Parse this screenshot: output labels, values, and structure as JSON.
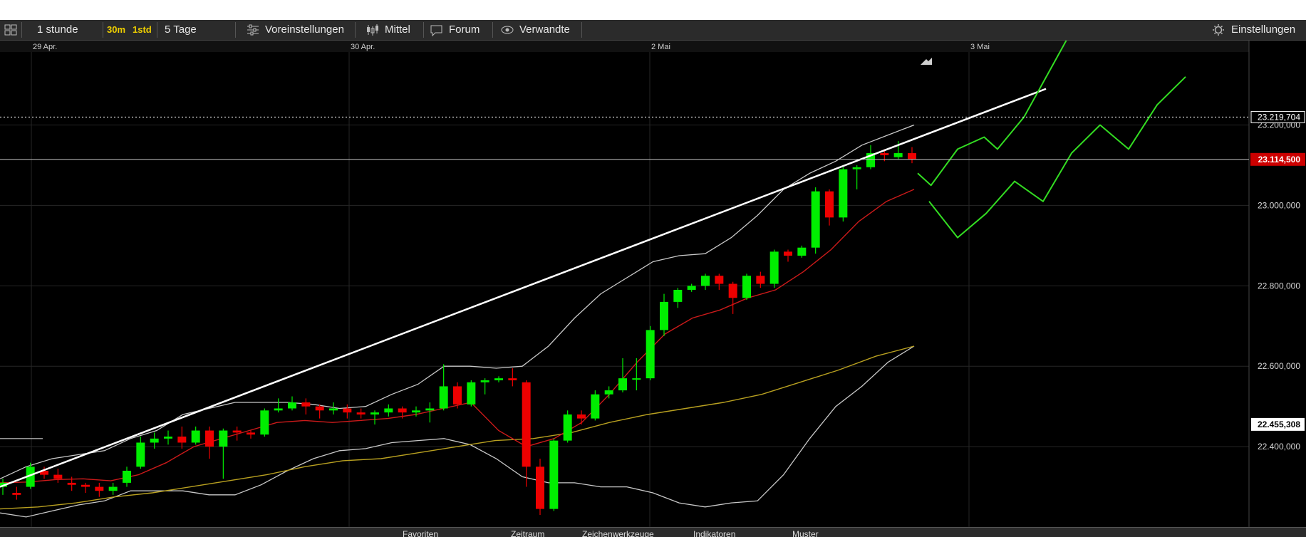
{
  "toolbar": {
    "interval": "1 stunde",
    "btn_30m": "30m",
    "btn_1std": "1std",
    "range": "5 Tage",
    "presets": "Voreinstellungen",
    "indicators": "Mittel",
    "forum": "Forum",
    "related": "Verwandte",
    "settings": "Einstellungen"
  },
  "bottom_tabs": [
    "Favoriten",
    "Zeitraum",
    "Zeichenwerkzeuge",
    "Indikatoren",
    "Muster"
  ],
  "colors": {
    "up": "#00ee00",
    "down": "#ee0000",
    "bollinger": "#c8c8c8",
    "ma_red": "#cc1a1a",
    "ma_yellow": "#b8a020",
    "trendline": "#ffffff",
    "forecast": "#33dd22",
    "current_price_bg": "#cc0000"
  },
  "chart_data": {
    "type": "candlestick",
    "x_labels": [
      "29 Apr.",
      "30 Apr.",
      "2 Mai",
      "3 Mai"
    ],
    "y_ticks": [
      "23.200,000",
      "23.000,000",
      "22.800,000",
      "22.600,000",
      "22.400,000"
    ],
    "y_tick_values": [
      23200,
      23000,
      22800,
      22600,
      22400
    ],
    "ylim": [
      22200,
      23410
    ],
    "price_markers": [
      {
        "label": "23.219,704",
        "value": 23219.704,
        "style": "dotted"
      },
      {
        "label": "23.114,500",
        "value": 23114.5,
        "style": "current"
      },
      {
        "label": "22.455,308",
        "value": 22455.308,
        "style": "plain"
      }
    ],
    "candles": [
      [
        22300,
        22310,
        22280,
        22320
      ],
      [
        22285,
        22280,
        22268,
        22300
      ],
      [
        22300,
        22350,
        22295,
        22360
      ],
      [
        22340,
        22330,
        22320,
        22350
      ],
      [
        22330,
        22320,
        22310,
        22345
      ],
      [
        22310,
        22305,
        22290,
        22325
      ],
      [
        22305,
        22300,
        22285,
        22310
      ],
      [
        22300,
        22290,
        22275,
        22310
      ],
      [
        22290,
        22300,
        22280,
        22310
      ],
      [
        22310,
        22340,
        22300,
        22350
      ],
      [
        22350,
        22410,
        22345,
        22425
      ],
      [
        22410,
        22420,
        22395,
        22435
      ],
      [
        22420,
        22425,
        22405,
        22440
      ],
      [
        22425,
        22410,
        22395,
        22450
      ],
      [
        22410,
        22440,
        22405,
        22450
      ],
      [
        22440,
        22400,
        22370,
        22450
      ],
      [
        22400,
        22440,
        22320,
        22445
      ],
      [
        22440,
        22435,
        22415,
        22450
      ],
      [
        22435,
        22430,
        22420,
        22440
      ],
      [
        22430,
        22490,
        22425,
        22495
      ],
      [
        22490,
        22495,
        22485,
        22520
      ],
      [
        22495,
        22510,
        22490,
        22525
      ],
      [
        22510,
        22500,
        22480,
        22520
      ],
      [
        22500,
        22490,
        22470,
        22505
      ],
      [
        22490,
        22495,
        22480,
        22510
      ],
      [
        22495,
        22485,
        22470,
        22505
      ],
      [
        22485,
        22480,
        22470,
        22495
      ],
      [
        22480,
        22485,
        22455,
        22490
      ],
      [
        22485,
        22495,
        22475,
        22505
      ],
      [
        22495,
        22485,
        22470,
        22500
      ],
      [
        22485,
        22490,
        22475,
        22500
      ],
      [
        22490,
        22495,
        22460,
        22510
      ],
      [
        22495,
        22550,
        22490,
        22605
      ],
      [
        22550,
        22505,
        22495,
        22560
      ],
      [
        22505,
        22560,
        22500,
        22565
      ],
      [
        22560,
        22565,
        22530,
        22570
      ],
      [
        22565,
        22570,
        22560,
        22575
      ],
      [
        22570,
        22565,
        22550,
        22595
      ],
      [
        22560,
        22350,
        22300,
        22565
      ],
      [
        22350,
        22245,
        22230,
        22370
      ],
      [
        22245,
        22415,
        22240,
        22420
      ],
      [
        22415,
        22480,
        22410,
        22490
      ],
      [
        22480,
        22470,
        22455,
        22490
      ],
      [
        22470,
        22530,
        22465,
        22540
      ],
      [
        22530,
        22540,
        22520,
        22550
      ],
      [
        22540,
        22570,
        22535,
        22620
      ],
      [
        22570,
        22570,
        22540,
        22620
      ],
      [
        22570,
        22690,
        22565,
        22700
      ],
      [
        22690,
        22760,
        22675,
        22780
      ],
      [
        22760,
        22790,
        22745,
        22795
      ],
      [
        22790,
        22800,
        22785,
        22805
      ],
      [
        22800,
        22825,
        22790,
        22830
      ],
      [
        22825,
        22805,
        22790,
        22830
      ],
      [
        22805,
        22770,
        22730,
        22810
      ],
      [
        22770,
        22825,
        22765,
        22830
      ],
      [
        22825,
        22805,
        22795,
        22835
      ],
      [
        22805,
        22885,
        22795,
        22890
      ],
      [
        22885,
        22875,
        22860,
        22890
      ],
      [
        22875,
        22895,
        22870,
        22900
      ],
      [
        22895,
        23035,
        22880,
        23045
      ],
      [
        23035,
        22970,
        22950,
        23040
      ],
      [
        22970,
        23090,
        22960,
        23095
      ],
      [
        23090,
        23095,
        23040,
        23100
      ],
      [
        23095,
        23130,
        23090,
        23150
      ],
      [
        23130,
        23125,
        23110,
        23140
      ],
      [
        23120,
        23130,
        23115,
        23160
      ],
      [
        23130,
        23115,
        23105,
        23145
      ]
    ],
    "bollinger_upper": [
      22320,
      22350,
      22370,
      22380,
      22390,
      22420,
      22440,
      22480,
      22495,
      22510,
      22510,
      22510,
      22505,
      22495,
      22500,
      22530,
      22555,
      22600,
      22600,
      22595,
      22600,
      22650,
      22720,
      22780,
      22820,
      22860,
      22875,
      22880,
      22920,
      22975,
      23040,
      23080,
      23110,
      23150,
      23175,
      23200
    ],
    "bollinger_lower": [
      22235,
      22225,
      22240,
      22255,
      22265,
      22290,
      22290,
      22290,
      22280,
      22280,
      22305,
      22340,
      22370,
      22390,
      22395,
      22410,
      22415,
      22420,
      22405,
      22370,
      22325,
      22310,
      22310,
      22300,
      22300,
      22285,
      22260,
      22250,
      22260,
      22265,
      22330,
      22420,
      22500,
      22550,
      22610,
      22650
    ],
    "ma_red": [
      22310,
      22312,
      22318,
      22320,
      22315,
      22330,
      22360,
      22400,
      22420,
      22440,
      22460,
      22465,
      22460,
      22465,
      22470,
      22480,
      22495,
      22510,
      22440,
      22400,
      22420,
      22460,
      22530,
      22610,
      22680,
      22720,
      22740,
      22770,
      22790,
      22835,
      22890,
      22960,
      23010,
      23040
    ],
    "ma_yellow": [
      22245,
      22250,
      22260,
      22275,
      22285,
      22300,
      22315,
      22330,
      22350,
      22365,
      22370,
      22385,
      22400,
      22415,
      22420,
      22435,
      22460,
      22480,
      22495,
      22510,
      22530,
      22560,
      22590,
      22625,
      22650
    ],
    "forecast_a": [
      [
        23080,
        0
      ],
      [
        23050,
        1
      ],
      [
        23140,
        3
      ],
      [
        23170,
        5
      ],
      [
        23140,
        6
      ],
      [
        23220,
        8
      ],
      [
        23340,
        10
      ],
      [
        23460,
        12
      ]
    ],
    "forecast_b": [
      [
        23010,
        0
      ],
      [
        22920,
        2
      ],
      [
        22980,
        4
      ],
      [
        23060,
        6
      ],
      [
        23010,
        8
      ],
      [
        23130,
        10
      ],
      [
        23200,
        12
      ],
      [
        23140,
        14
      ],
      [
        23250,
        16
      ],
      [
        23320,
        18
      ]
    ],
    "trendline": {
      "y_start": 22300,
      "y_end": 23290
    }
  }
}
